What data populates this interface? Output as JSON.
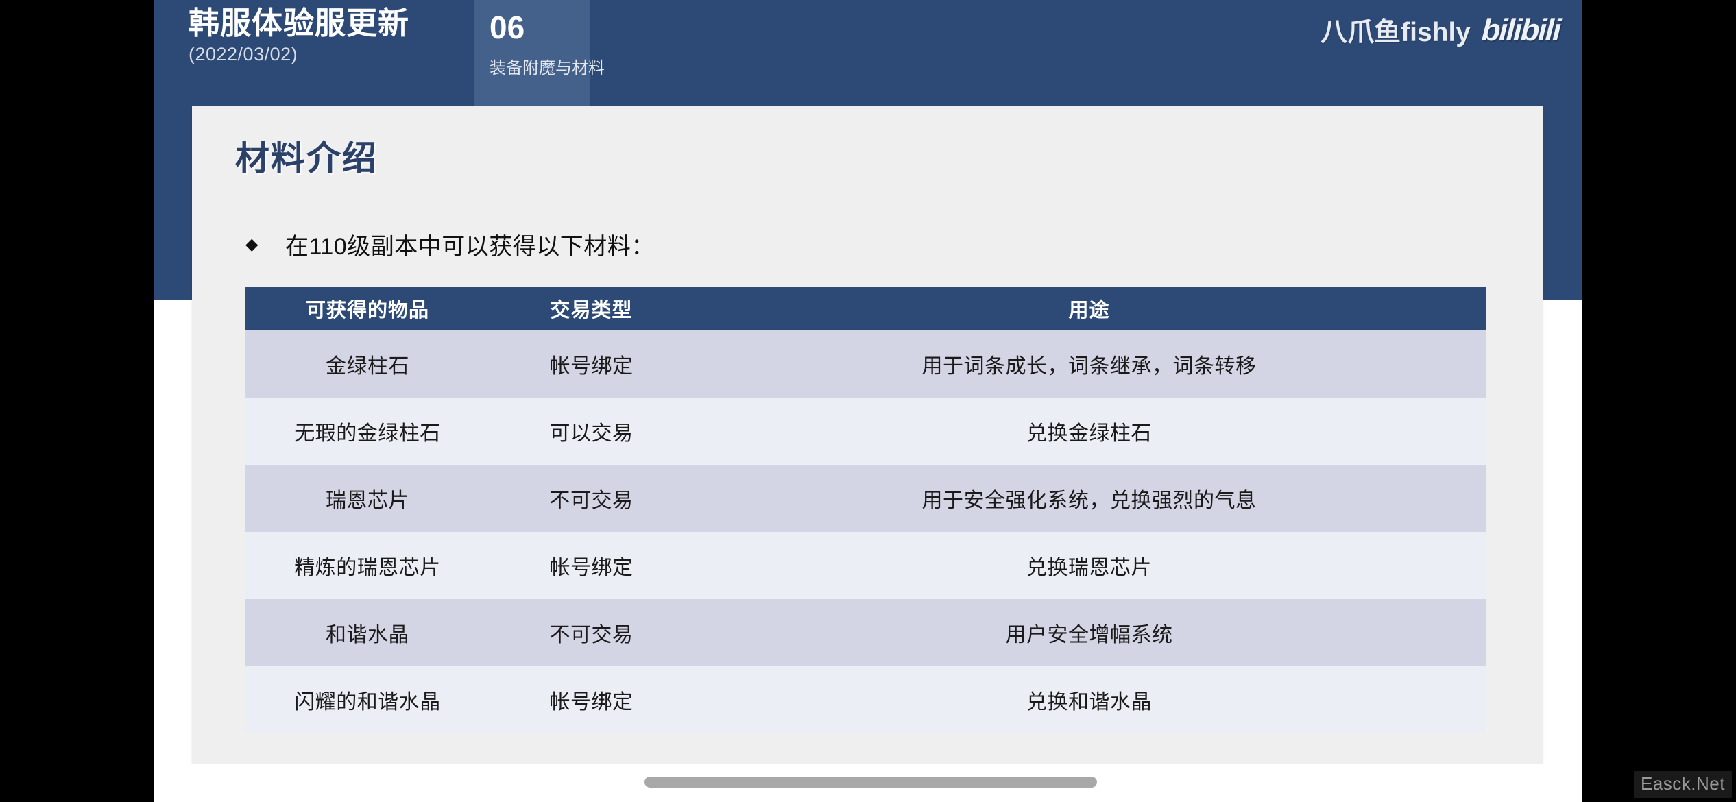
{
  "header": {
    "deck_title": "韩服体验服更新",
    "deck_date": "(2022/03/02)",
    "section_number": "06",
    "section_subtitle": "装备附魔与材料",
    "brand_author": "八爪鱼fishly",
    "brand_platform": "bilibili",
    "band_color": "#2c4a75",
    "chip_color": "#44618c"
  },
  "slide": {
    "heading": "材料介绍",
    "bullet_marker": "◆",
    "bullet_text": "在110级副本中可以获得以下材料：",
    "card_background": "#efeff0",
    "heading_color": "#2c416a"
  },
  "table": {
    "headers": [
      "可获得的物品",
      "交易类型",
      "用途"
    ],
    "header_background": "#2c4a75",
    "row_odd_background": "#d3d4e4",
    "row_even_background": "#eceef6",
    "rows": [
      {
        "item": "金绿柱石",
        "trade_type": "帐号绑定",
        "use": "用于词条成长，词条继承，词条转移"
      },
      {
        "item": "无瑕的金绿柱石",
        "trade_type": "可以交易",
        "use": "兑换金绿柱石"
      },
      {
        "item": "瑞恩芯片",
        "trade_type": "不可交易",
        "use": "用于安全强化系统，兑换强烈的气息"
      },
      {
        "item": "精炼的瑞恩芯片",
        "trade_type": "帐号绑定",
        "use": "兑换瑞恩芯片"
      },
      {
        "item": "和谐水晶",
        "trade_type": "不可交易",
        "use": "用户安全增幅系统"
      },
      {
        "item": "闪耀的和谐水晶",
        "trade_type": "帐号绑定",
        "use": "兑换和谐水晶"
      }
    ]
  },
  "footer": {
    "watermark": "Easck.Net"
  }
}
